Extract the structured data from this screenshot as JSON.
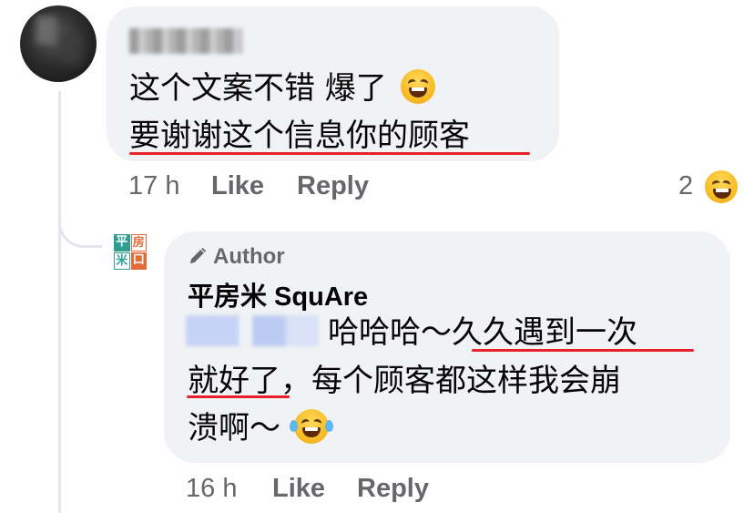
{
  "comment1": {
    "line1": "这个文案不错 爆了",
    "line2": "要谢谢这个信息你的顾客",
    "time": "17 h",
    "like_label": "Like",
    "reply_label": "Reply",
    "reaction_count": "2"
  },
  "reply1": {
    "author_badge": "Author",
    "page_name": "平房米 SquAre",
    "logo_chars": [
      "平",
      "房",
      "米",
      "口"
    ],
    "line1": "哈哈哈～久久遇到一次",
    "line2": "就好了，每个顾客都这样我会崩",
    "line3": "溃啊～",
    "time": "16 h",
    "like_label": "Like",
    "reply_label": "Reply"
  },
  "colors": {
    "bubble": "#f0f2f5",
    "meta_text": "#65676b",
    "underline": "#e8202a",
    "thread_line": "#e4e6eb"
  },
  "icons": {
    "emoji1": "grinning-squinting-face-icon",
    "reaction": "haha-reaction-icon",
    "author": "pen-icon",
    "emoji2": "tears-of-joy-face-icon"
  }
}
